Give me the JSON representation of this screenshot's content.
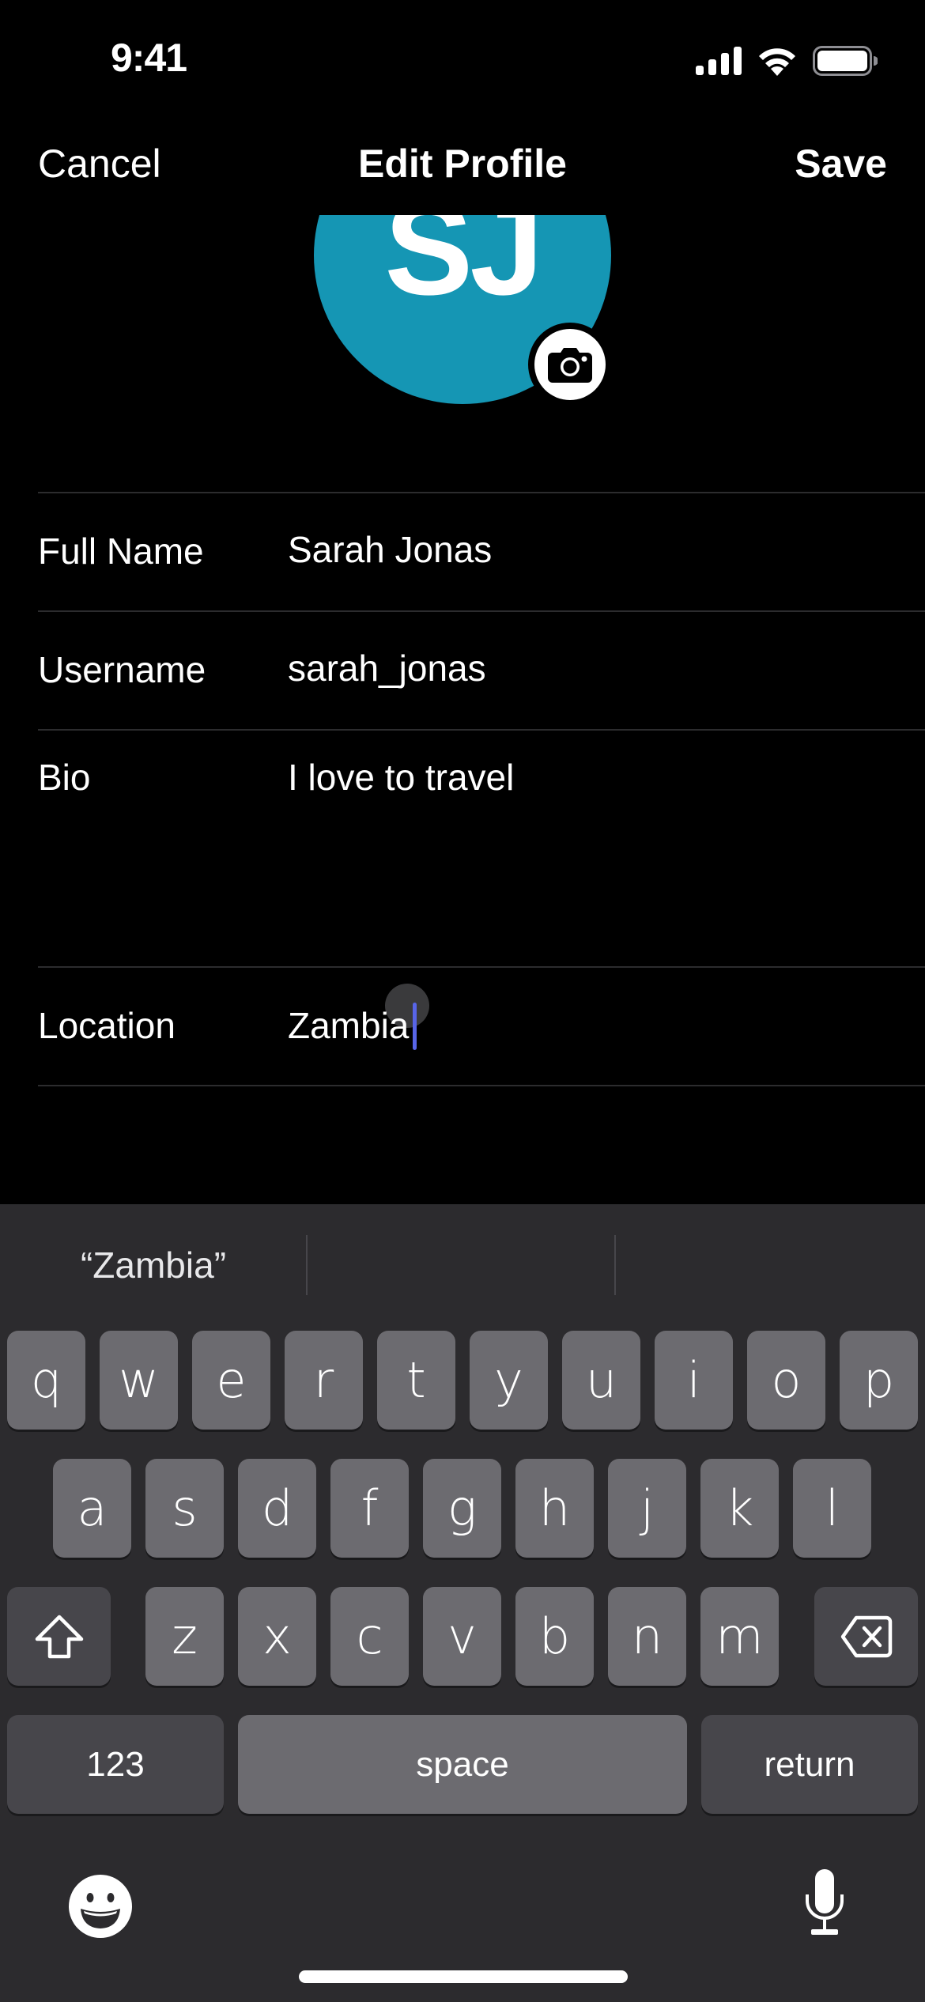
{
  "status_bar": {
    "time": "9:41"
  },
  "nav": {
    "cancel_label": "Cancel",
    "title": "Edit Profile",
    "save_label": "Save"
  },
  "avatar": {
    "initials": "SJ",
    "color": "#1596b4"
  },
  "form": {
    "rows": [
      {
        "label": "Full Name",
        "value": "Sarah Jonas"
      },
      {
        "label": "Username",
        "value": "sarah_jonas"
      },
      {
        "label": "Bio",
        "value": "I love to travel"
      },
      {
        "label": "Location",
        "value": "Zambia"
      }
    ]
  },
  "keyboard": {
    "suggestions": [
      "“Zambia”",
      "",
      ""
    ],
    "row1": [
      "q",
      "w",
      "e",
      "r",
      "t",
      "y",
      "u",
      "i",
      "o",
      "p"
    ],
    "row2": [
      "a",
      "s",
      "d",
      "f",
      "g",
      "h",
      "j",
      "k",
      "l"
    ],
    "row3": [
      "z",
      "x",
      "c",
      "v",
      "b",
      "n",
      "m"
    ],
    "numbers_label": "123",
    "space_label": "space",
    "return_label": "return"
  },
  "colors": {
    "cursor": "#5865e8",
    "keyboard_bg": "#2c2b2e",
    "key": "#6c6b70",
    "key_dark": "#47464b"
  }
}
